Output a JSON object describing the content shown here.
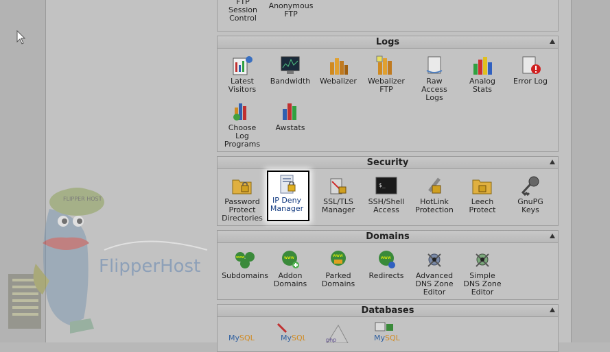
{
  "ftp": {
    "items": [
      {
        "label": "FTP\nSession\nControl",
        "icon": "ftp-session-icon"
      },
      {
        "label": "Anonymous\nFTP",
        "icon": "anonymous-ftp-icon"
      }
    ]
  },
  "logs": {
    "title": "Logs",
    "items": [
      {
        "label": "Latest\nVisitors",
        "icon": "latest-visitors-icon"
      },
      {
        "label": "Bandwidth",
        "icon": "bandwidth-icon"
      },
      {
        "label": "Webalizer",
        "icon": "webalizer-icon"
      },
      {
        "label": "Webalizer\nFTP",
        "icon": "webalizer-ftp-icon"
      },
      {
        "label": "Raw\nAccess\nLogs",
        "icon": "raw-access-logs-icon"
      },
      {
        "label": "Analog\nStats",
        "icon": "analog-stats-icon"
      },
      {
        "label": "Error Log",
        "icon": "error-log-icon"
      },
      {
        "label": "Choose\nLog\nPrograms",
        "icon": "choose-log-programs-icon"
      },
      {
        "label": "Awstats",
        "icon": "awstats-icon"
      }
    ]
  },
  "security": {
    "title": "Security",
    "items": [
      {
        "label": "Password\nProtect\nDirectories",
        "icon": "password-protect-icon"
      },
      {
        "label": "IP Deny\nManager",
        "icon": "ip-deny-manager-icon"
      },
      {
        "label": "SSL/TLS\nManager",
        "icon": "ssl-tls-icon"
      },
      {
        "label": "SSH/Shell\nAccess",
        "icon": "ssh-shell-icon"
      },
      {
        "label": "HotLink\nProtection",
        "icon": "hotlink-protection-icon"
      },
      {
        "label": "Leech\nProtect",
        "icon": "leech-protect-icon"
      },
      {
        "label": "GnuPG\nKeys",
        "icon": "gnupg-keys-icon"
      }
    ]
  },
  "domains": {
    "title": "Domains",
    "items": [
      {
        "label": "Subdomains",
        "icon": "subdomains-icon"
      },
      {
        "label": "Addon\nDomains",
        "icon": "addon-domains-icon"
      },
      {
        "label": "Parked\nDomains",
        "icon": "parked-domains-icon"
      },
      {
        "label": "Redirects",
        "icon": "redirects-icon"
      },
      {
        "label": "Advanced\nDNS Zone\nEditor",
        "icon": "advanced-dns-icon"
      },
      {
        "label": "Simple\nDNS Zone\nEditor",
        "icon": "simple-dns-icon"
      }
    ]
  },
  "databases": {
    "title": "Databases"
  },
  "logo": {
    "text": "FlipperHost",
    "cap_text": "FLIPPER HOST"
  },
  "colors": {
    "panel_bg": "#c3c3c3",
    "highlight_bg": "#ffffff",
    "link_text": "#123a80"
  }
}
